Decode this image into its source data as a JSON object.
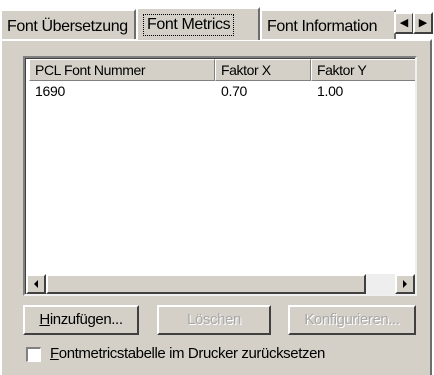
{
  "tabs": [
    {
      "label": "Font Übersetzung",
      "active": false
    },
    {
      "label": "Font Metrics",
      "active": true
    },
    {
      "label": "Font Information",
      "active": false
    }
  ],
  "tab_scroll": {
    "left_icon": "arrow-left-icon",
    "right_icon": "arrow-right-icon",
    "left_glyph": "◀",
    "right_glyph": "▶"
  },
  "list": {
    "columns": [
      "PCL Font Nummer",
      "Faktor X",
      "Faktor Y"
    ],
    "rows": [
      [
        "1690",
        "0.70",
        "1.00"
      ]
    ]
  },
  "scrollbar": {
    "left_icon": "arrow-left-icon",
    "right_icon": "arrow-right-icon"
  },
  "buttons": {
    "add": {
      "mnemonic": "H",
      "rest": "inzufügen...",
      "enabled": true
    },
    "delete": {
      "label": "Löschen",
      "enabled": false
    },
    "configure": {
      "label": "Konfigurieren...",
      "enabled": false
    }
  },
  "checkbox": {
    "mnemonic": "F",
    "rest": "ontmetricstabelle im Drucker zurücksetzen",
    "checked": false
  },
  "colors": {
    "face": "#d4d0c8",
    "highlight": "#ffffff",
    "shadow": "#808080",
    "dark_shadow": "#404040",
    "disabled_text": "#a8a8a8"
  }
}
